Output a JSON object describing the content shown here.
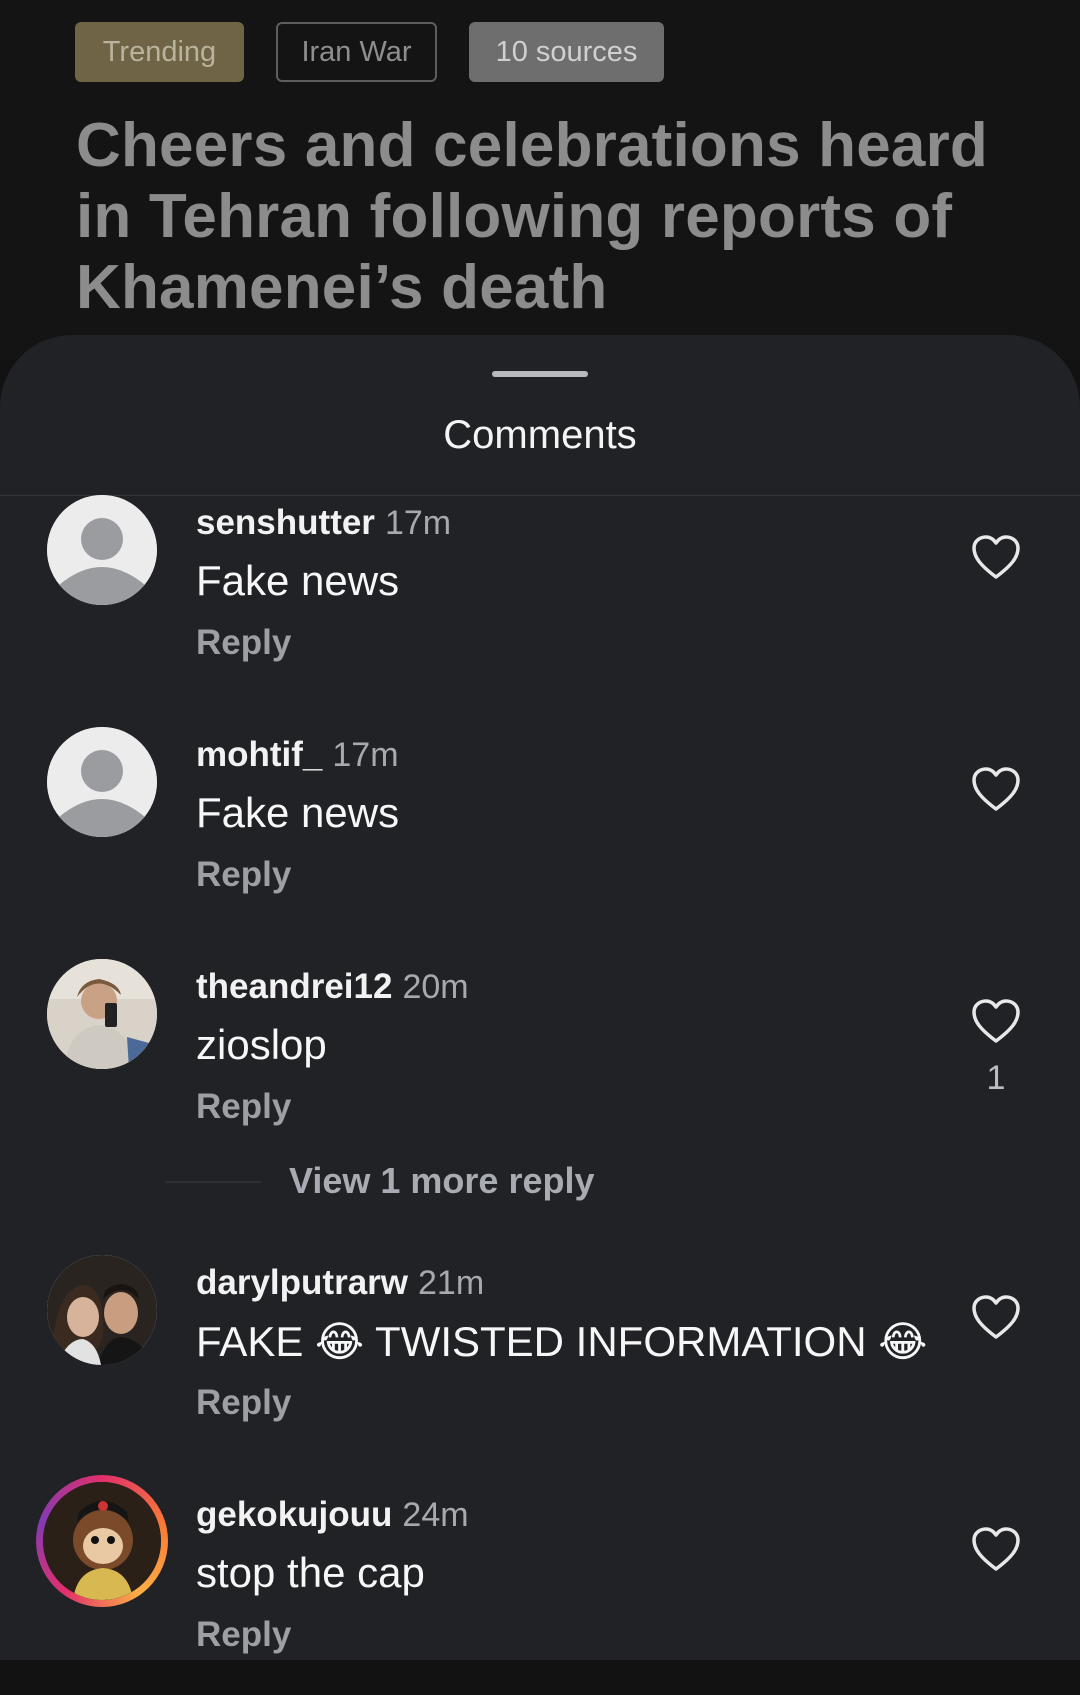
{
  "header": {
    "chips": {
      "trending": "Trending",
      "topic": "Iran War",
      "sources": "10 sources"
    },
    "headline": "Cheers and celebrations heard in Tehran following reports of Khamenei’s death"
  },
  "sheet": {
    "title": "Comments"
  },
  "comments": [
    {
      "username": "senshutter",
      "time": "17m",
      "text": "Fake news",
      "reply": "Reply",
      "likes": ""
    },
    {
      "username": "mohtif_",
      "time": "17m",
      "text": "Fake news",
      "reply": "Reply",
      "likes": ""
    },
    {
      "username": "theandrei12",
      "time": "20m",
      "text": "zioslop",
      "reply": "Reply",
      "likes": "1"
    },
    {
      "username": "darylputrarw",
      "time": "21m",
      "text": "FAKE 😂 TWISTED INFORMATION 😂",
      "reply": "Reply",
      "likes": ""
    },
    {
      "username": "gekokujouu",
      "time": "24m",
      "text": "stop the cap",
      "reply": "Reply",
      "likes": ""
    }
  ],
  "thread": {
    "view_more": "View 1 more reply"
  },
  "icons": {
    "like": "heart-outline-icon",
    "default_avatar": "default-avatar-icon"
  },
  "colors": {
    "sheet_background": "#202226",
    "header_background": "#141414",
    "trending_chip": "#6f6445"
  }
}
